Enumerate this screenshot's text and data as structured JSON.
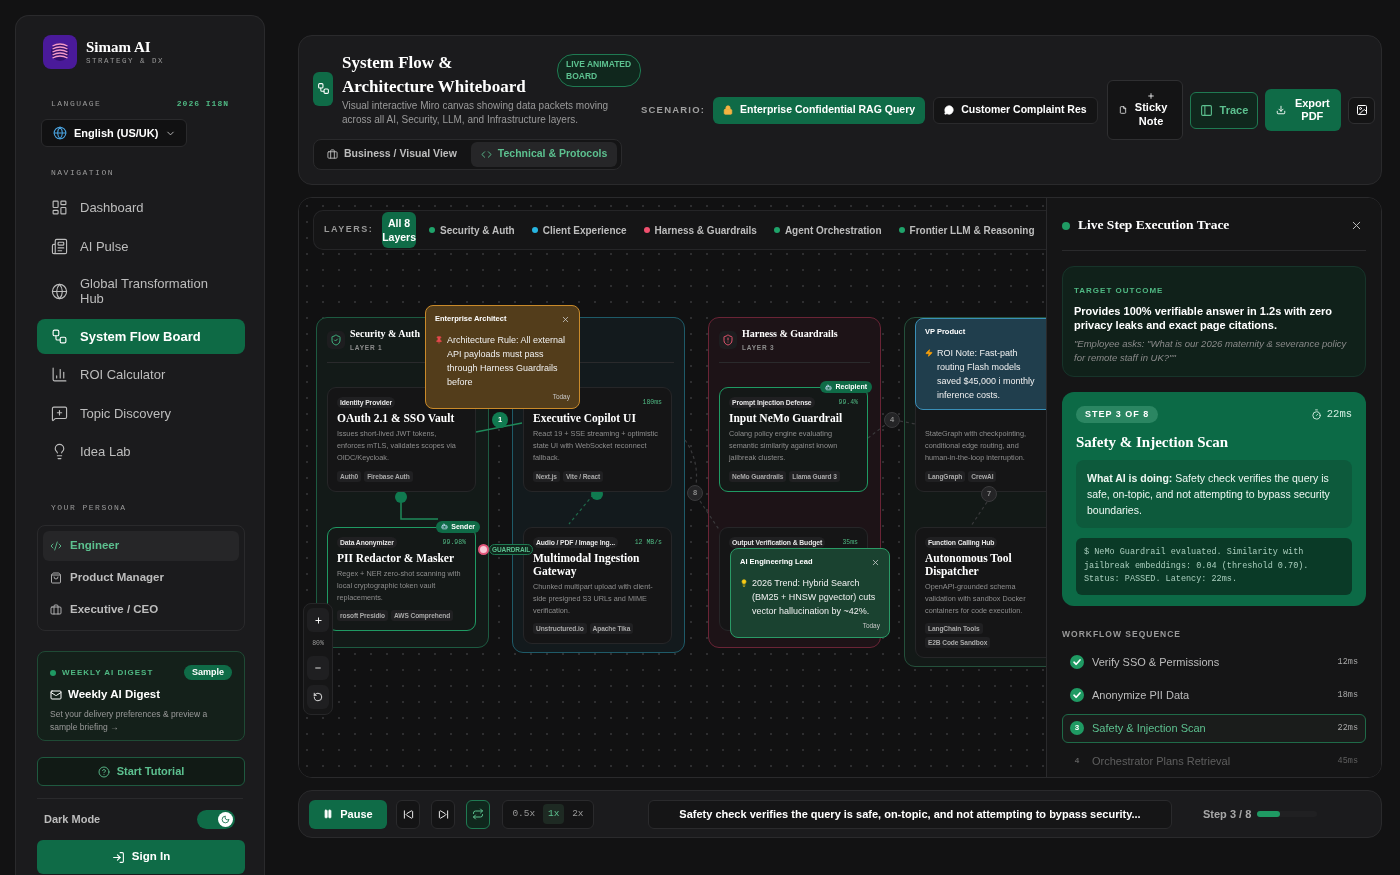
{
  "sidebar": {
    "brand": {
      "name": "Simam AI",
      "tagline": "STRATEGY & DX"
    },
    "language": {
      "label": "LANGUAGE",
      "badge": "2026 I18N",
      "value": "English (US/UK)"
    },
    "navigation": {
      "label": "NAVIGATION",
      "items": [
        {
          "label": "Dashboard",
          "selected": false
        },
        {
          "label": "AI Pulse",
          "selected": false
        },
        {
          "label": "Global Transformation Hub",
          "selected": false
        },
        {
          "label": "System Flow Board",
          "selected": true
        },
        {
          "label": "ROI Calculator",
          "selected": false
        },
        {
          "label": "Topic Discovery",
          "selected": false
        },
        {
          "label": "Idea Lab",
          "selected": false
        }
      ]
    },
    "persona": {
      "label": "YOUR PERSONA",
      "items": [
        {
          "label": "Engineer",
          "selected": true
        },
        {
          "label": "Product Manager",
          "selected": false
        },
        {
          "label": "Executive / CEO",
          "selected": false
        }
      ]
    },
    "digest": {
      "label": "WEEKLY AI DIGEST",
      "badge": "Sample",
      "title": "Weekly AI Digest",
      "text": "Set your delivery preferences & preview a sample briefing →"
    },
    "tutorial_button": "Start Tutorial",
    "dark_mode": {
      "label": "Dark Mode",
      "on": true
    },
    "sign_in_button": "Sign In"
  },
  "header": {
    "title": "System Flow & Architecture Whiteboard",
    "badge": "LIVE ANIMATED BOARD",
    "subtitle": "Visual interactive Miro canvas showing data packets moving across all AI, Security, LLM, and Infrastructure layers.",
    "views": [
      {
        "label": "Business / Visual View",
        "selected": false
      },
      {
        "label": "Technical & Protocols",
        "selected": true
      }
    ],
    "scenario_label": "SCENARIO:",
    "scenarios": [
      {
        "label": "Enterprise Confidential RAG Query",
        "selected": true
      },
      {
        "label": "Customer Complaint Res",
        "selected": false
      }
    ],
    "sticky_note_button": "Sticky Note",
    "trace_button": {
      "label": "Trace",
      "on": true
    },
    "export_button": "Export PDF"
  },
  "canvas": {
    "layers_label": "LAYERS:",
    "layer_filters": [
      {
        "kind": "all",
        "label": "All 8 Layers",
        "selected": true
      },
      {
        "kind": "layer",
        "label": "Security & Auth",
        "selected": false,
        "color": "#1fa36a"
      },
      {
        "kind": "layer",
        "label": "Client Experience",
        "selected": false,
        "color": "#27b5e0"
      },
      {
        "kind": "layer",
        "label": "Harness & Guardrails",
        "selected": false,
        "color": "#f0506e"
      },
      {
        "kind": "layer",
        "label": "Agent Orchestration",
        "selected": false,
        "color": "#1fa36a"
      },
      {
        "kind": "layer",
        "label": "Frontier LLM & Reasoning",
        "selected": false,
        "color": "#1fa36a"
      }
    ],
    "columns": [
      {
        "title": "Security & Auth",
        "layer": "LAYER 1",
        "color": "#1d5a41",
        "cards": [
          {
            "tag": "Identity Provider",
            "title": "OAuth 2.1 & SSO Vault",
            "text": "Issues short-lived JWT tokens, enforces mTLS, validates scopes via OIDC/Keycloak.",
            "tags": [
              "Auth0",
              "Firebase Auth"
            ],
            "highlighted": false
          },
          {
            "tag": "Data Anonymizer",
            "metric": "99.98%",
            "title": "PII Redactor & Masker",
            "text": "Regex + NER zero-shot scanning with local cryptographic token vault replacements.",
            "tags": [
              "rosoft Presidio",
              "AWS Comprehend"
            ],
            "highlighted": true,
            "badge": "Sender"
          }
        ]
      },
      {
        "color": "#1e5a68",
        "cards": [
          {
            "metric": "180ms",
            "title": "Executive Copilot UI",
            "text": "React 19 + SSE streaming + optimistic state UI with WebSocket reconnect fallback.",
            "tags": [
              "Next.js",
              "Vite / React"
            ],
            "highlighted": false
          },
          {
            "tag": "Audio / PDF / Image Ing...",
            "metric": "12 MB/s",
            "title": "Multimodal Ingestion Gateway",
            "text": "Chunked multipart upload with client-side presigned S3 URLs and MIME verification.",
            "tags": [
              "Unstructured.io",
              "Apache Tika"
            ],
            "highlighted": false
          }
        ]
      },
      {
        "title": "Harness & Guardrails",
        "layer": "LAYER 3",
        "color": "#6a2436",
        "cards": [
          {
            "tag": "Prompt Injection Defense",
            "metric": "99.4%",
            "title": "Input NeMo Guardrail",
            "text": "Colang policy engine evaluating semantic similarity against known jailbreak clusters.",
            "tags": [
              "NeMo Guardrails",
              "Llama Guard 3"
            ],
            "highlighted": true,
            "badge": "Recipient"
          },
          {
            "tag": "Output Verification & Budget",
            "metric": "35ms",
            "highlighted": false
          }
        ]
      },
      {
        "color": "#24503b",
        "cards": [
          {
            "text": "StateGraph with checkpointing, conditional edge routing, and human-in-the-loop interruption.",
            "tags": [
              "LangGraph",
              "CrewAI"
            ],
            "highlighted": false
          },
          {
            "tag": "Function Calling Hub",
            "title": "Autonomous Tool Dispatcher",
            "text": "OpenAPI-grounded schema validation with sandbox Docker containers for code execution.",
            "tags": [
              "LangChain Tools",
              "E2B Code Sandbox"
            ],
            "highlighted": false
          }
        ]
      }
    ],
    "step_markers": [
      {
        "label": "1",
        "done": true
      },
      {
        "label": "4",
        "done": false
      },
      {
        "label": "8",
        "done": false
      },
      {
        "label": "7",
        "done": false
      }
    ],
    "edge_label": "GUARDRAIL",
    "notes": [
      {
        "author": "Enterprise Architect",
        "text": "Architecture Rule: All external API payloads must pass through Harness Guardrails before",
        "date": "Today",
        "color": "#c98a2a",
        "closable": true
      },
      {
        "author": "VP Product",
        "text": "ROI Note: Fast-path routing Flash models saved $45,000 i monthly inference costs.",
        "color": "#3a8fb7",
        "closable": false
      },
      {
        "author": "AI Engineering Lead",
        "text": "2026 Trend: Hybrid Search (BM25 + HNSW pgvector) cuts vector hallucination by ~42%.",
        "date": "Today",
        "color": "#2a9a66",
        "closable": true
      }
    ],
    "zoom_label": "80%"
  },
  "trace": {
    "title": "Live Step Execution Trace",
    "target": {
      "label": "TARGET OUTCOME",
      "text": "Provides 100% verifiable answer in 1.2s with zero privacy leaks and exact page citations.",
      "quote": "\"Employee asks: \"What is our 2026 maternity & severance policy for remote staff in UK?\"\""
    },
    "step": {
      "badge": "STEP 3 OF 8",
      "time": "22ms",
      "title": "Safety & Injection Scan",
      "description": "**What AI is doing:** Safety check verifies the query is safe, on-topic, and not attempting to bypass security boundaries.",
      "log": "$ NeMo Guardrail evaluated. Similarity with jailbreak embeddings: 0.04 (threshold 0.70). Status: PASSED. Latency: 22ms."
    },
    "sequence_label": "WORKFLOW SEQUENCE",
    "sequence": [
      {
        "label": "Verify SSO & Permissions",
        "time": "12ms",
        "done": true,
        "selected": false
      },
      {
        "label": "Anonymize PII Data",
        "time": "18ms",
        "done": true,
        "selected": false
      },
      {
        "number": "3",
        "label": "Safety & Injection Scan",
        "time": "22ms",
        "done": false,
        "selected": true
      },
      {
        "number": "4",
        "label": "Orchestrator Plans Retrieval",
        "time": "45ms",
        "done": false,
        "selected": false
      }
    ]
  },
  "player": {
    "pause_button": "Pause",
    "repeat_on": true,
    "speeds": [
      {
        "label": "0.5x",
        "selected": false
      },
      {
        "label": "1x",
        "selected": true
      },
      {
        "label": "2x",
        "selected": false
      }
    ],
    "caption": "Safety check verifies the query is safe, on-topic, and not attempting to bypass security...",
    "step_label": "Step 3 / 8",
    "level": 0.375
  }
}
